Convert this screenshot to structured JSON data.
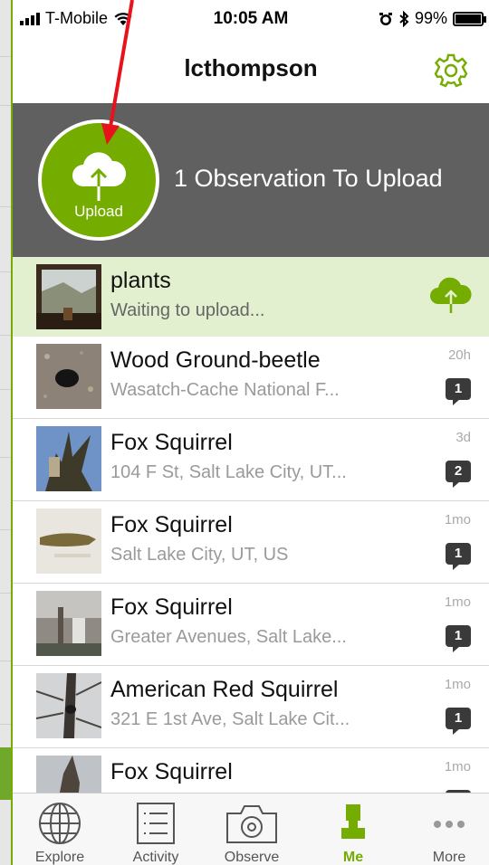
{
  "status": {
    "carrier": "T-Mobile",
    "time": "10:05 AM",
    "battery": "99%"
  },
  "nav": {
    "title": "lcthompson"
  },
  "banner": {
    "upload_label": "Upload",
    "message": "1 Observation To Upload"
  },
  "observations": [
    {
      "name": "plants",
      "sub": "Waiting to upload...",
      "time": "",
      "comments": "",
      "pending": true
    },
    {
      "name": "Wood Ground-beetle",
      "sub": "Wasatch-Cache National F...",
      "time": "20h",
      "comments": "1"
    },
    {
      "name": "Fox Squirrel",
      "sub": "104 F St, Salt Lake City, UT...",
      "time": "3d",
      "comments": "2"
    },
    {
      "name": "Fox Squirrel",
      "sub": "Salt Lake City, UT, US",
      "time": "1mo",
      "comments": "1"
    },
    {
      "name": "Fox Squirrel",
      "sub": "Greater Avenues, Salt Lake...",
      "time": "1mo",
      "comments": "1"
    },
    {
      "name": "American Red Squirrel",
      "sub": "321 E 1st Ave, Salt Lake Cit...",
      "time": "1mo",
      "comments": "1"
    },
    {
      "name": "Fox Squirrel",
      "sub": "",
      "time": "1mo",
      "comments": ""
    }
  ],
  "tabs": [
    {
      "label": "Explore",
      "icon": "globe-icon"
    },
    {
      "label": "Activity",
      "icon": "list-icon"
    },
    {
      "label": "Observe",
      "icon": "camera-icon"
    },
    {
      "label": "Me",
      "icon": "person-icon",
      "active": true
    },
    {
      "label": "More",
      "icon": "more-icon"
    }
  ],
  "colors": {
    "accent": "#74ac00",
    "banner_bg": "#606060",
    "pending_row_bg": "#e3f0d0",
    "annotation_arrow": "#e8121b"
  }
}
